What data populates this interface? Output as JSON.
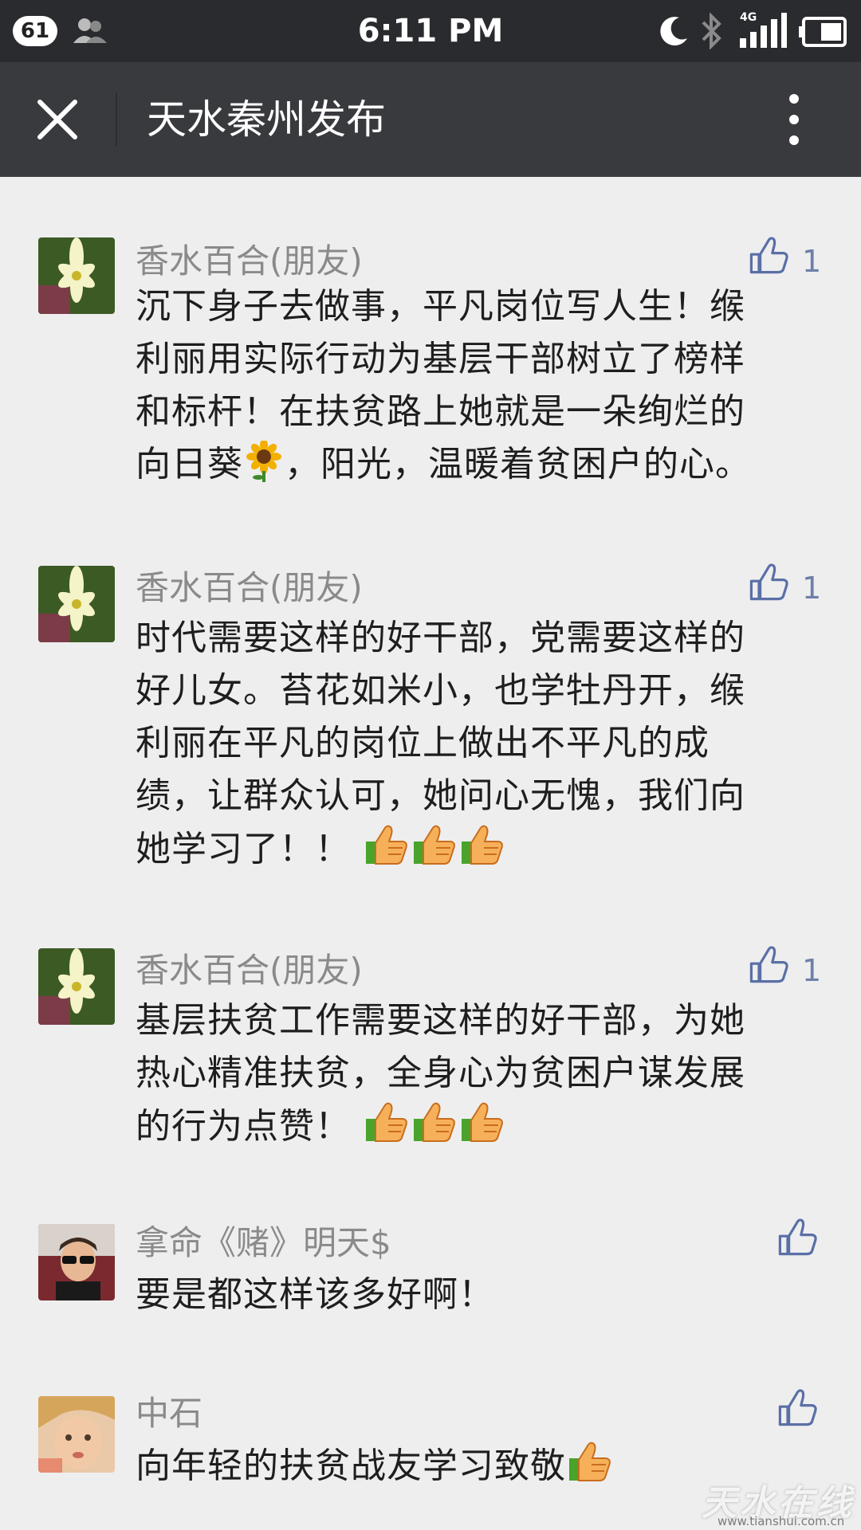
{
  "status_bar": {
    "notification_count": "61",
    "time": "6:11 PM",
    "network": "4G"
  },
  "header": {
    "title": "天水秦州发布"
  },
  "comments": [
    {
      "author": "香水百合(朋友)",
      "likes": "1",
      "lines": [
        "沉下身子去做事，平凡岗位写人生！缑",
        "利丽用实际行动为基层干部树立了榜样",
        "和标杆！在扶贫路上她就是一朵绚烂的",
        "向日葵",
        "，阳光，温暖着贫困户的心。"
      ]
    },
    {
      "author": "香水百合(朋友)",
      "likes": "1",
      "lines": [
        "时代需要这样的好干部，党需要这样的",
        "好儿女。苔花如米小，也学牡丹开，缑",
        "利丽在平凡的岗位上做出不平凡的成",
        "绩，让群众认可，她问心无愧，我们向",
        "她学习了！！"
      ]
    },
    {
      "author": "香水百合(朋友)",
      "likes": "1",
      "lines": [
        "基层扶贫工作需要这样的好干部，为她",
        "热心精准扶贫，全身心为贫困户谋发展",
        "的行为点赞！"
      ]
    },
    {
      "author": "拿命《赌》明天$",
      "lines": [
        "要是都这样该多好啊！"
      ]
    },
    {
      "author": "中石",
      "lines": [
        "向年轻的扶贫战友学习致敬"
      ]
    }
  ],
  "watermark": {
    "title": "天水在线",
    "url": "www.tianshui.com.cn"
  },
  "colors": {
    "status_bar": "#2a2b2f",
    "app_bar": "#393a3e",
    "background": "#eeeeef",
    "like_blue": "#5a6fa6",
    "author_gray": "#8a8a8a"
  }
}
